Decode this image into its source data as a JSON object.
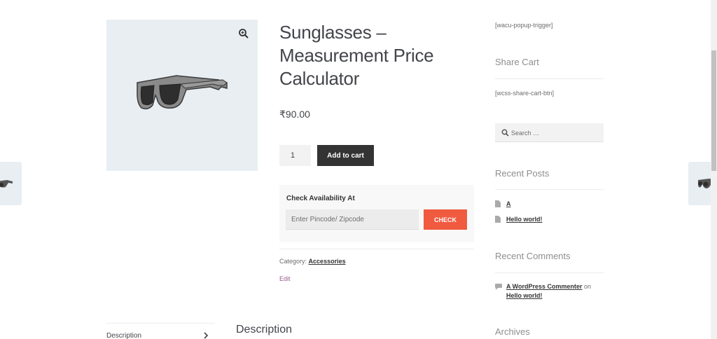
{
  "product": {
    "title_line1": "Sunglasses –",
    "title_line2": "Measurement Price",
    "title_line3": "Calculator",
    "price": "₹90.00",
    "quantity": "1",
    "add_to_cart_label": "Add to cart",
    "zoom_icon": "magnifier-zoom-icon",
    "image_alt": "sunglasses"
  },
  "availability": {
    "label": "Check Availability At",
    "pincode_placeholder": "Enter Pincode/ Zipcode",
    "check_label": "CHECK"
  },
  "meta": {
    "category_prefix": "Category:",
    "category": "Accessories",
    "edit_label": "Edit"
  },
  "tabs": {
    "description_tab": "Description",
    "description_heading": "Description",
    "chevron_icon": "chevron-right-icon"
  },
  "sidebar": {
    "popup_shortcode": "[wacu-popup-trigger]",
    "share_cart_title": "Share Cart",
    "share_cart_shortcode": "[wcss-share-cart-btn]",
    "search_placeholder": "Search …",
    "recent_posts_title": "Recent Posts",
    "recent_posts": [
      "A",
      "Hello world!"
    ],
    "recent_comments_title": "Recent Comments",
    "comment_author": "A WordPress Commenter",
    "comment_on": "on",
    "comment_post": "Hello world!",
    "archives_title": "Archives"
  },
  "colors": {
    "accent_button": "#f05a3f",
    "dark_button": "#333333",
    "image_bg": "#e9eef3"
  }
}
